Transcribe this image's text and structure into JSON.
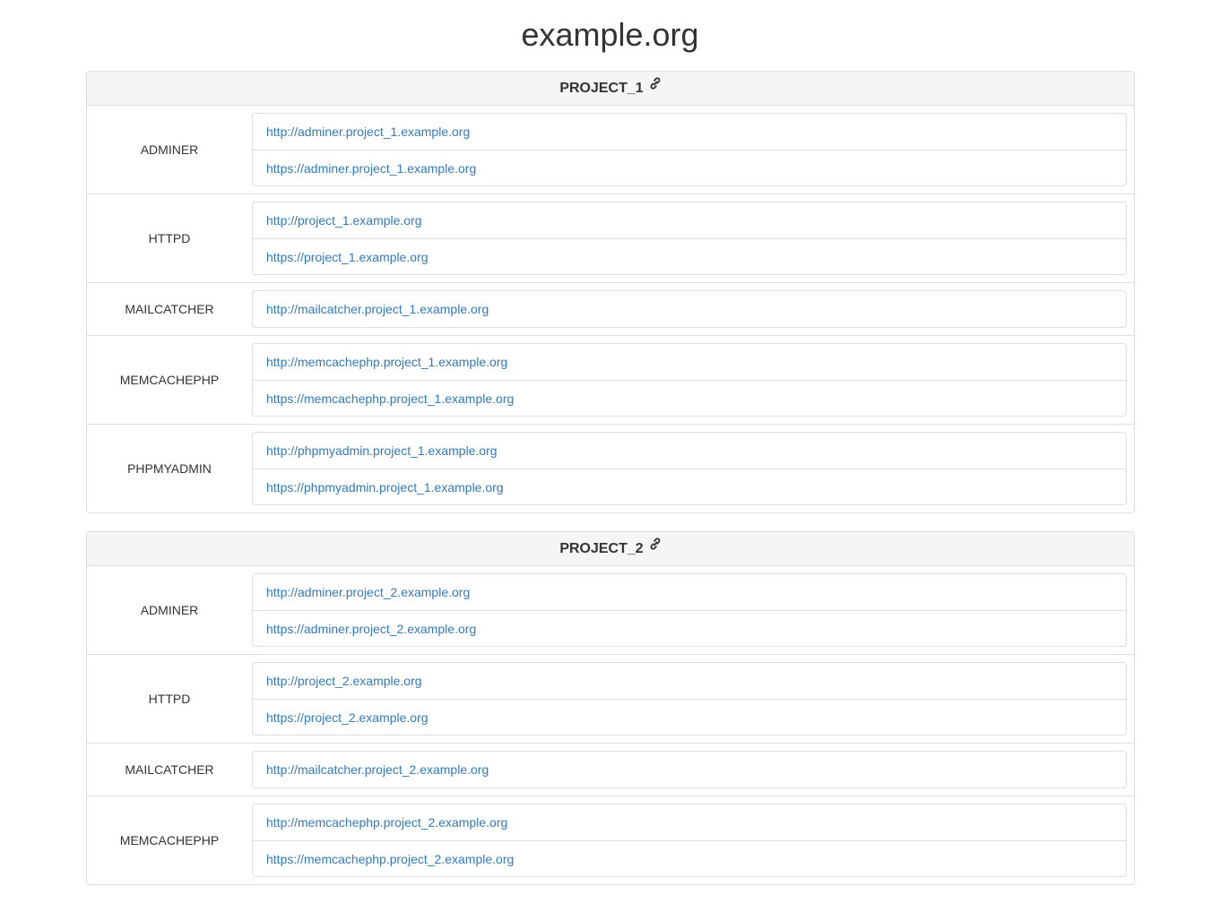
{
  "page": {
    "title": "example.org"
  },
  "colors": {
    "link": "#337ab7",
    "border": "#dddddd",
    "heading_bg": "#f5f5f5"
  },
  "projects": [
    {
      "name": "PROJECT_1",
      "icon": "link-icon",
      "services": [
        {
          "name": "ADMINER",
          "urls": [
            "http://adminer.project_1.example.org",
            "https://adminer.project_1.example.org"
          ]
        },
        {
          "name": "HTTPD",
          "urls": [
            "http://project_1.example.org",
            "https://project_1.example.org"
          ]
        },
        {
          "name": "MAILCATCHER",
          "urls": [
            "http://mailcatcher.project_1.example.org"
          ]
        },
        {
          "name": "MEMCACHEPHP",
          "urls": [
            "http://memcachephp.project_1.example.org",
            "https://memcachephp.project_1.example.org"
          ]
        },
        {
          "name": "PHPMYADMIN",
          "urls": [
            "http://phpmyadmin.project_1.example.org",
            "https://phpmyadmin.project_1.example.org"
          ]
        }
      ]
    },
    {
      "name": "PROJECT_2",
      "icon": "link-icon",
      "services": [
        {
          "name": "ADMINER",
          "urls": [
            "http://adminer.project_2.example.org",
            "https://adminer.project_2.example.org"
          ]
        },
        {
          "name": "HTTPD",
          "urls": [
            "http://project_2.example.org",
            "https://project_2.example.org"
          ]
        },
        {
          "name": "MAILCATCHER",
          "urls": [
            "http://mailcatcher.project_2.example.org"
          ]
        },
        {
          "name": "MEMCACHEPHP",
          "urls": [
            "http://memcachephp.project_2.example.org",
            "https://memcachephp.project_2.example.org"
          ]
        }
      ]
    }
  ]
}
